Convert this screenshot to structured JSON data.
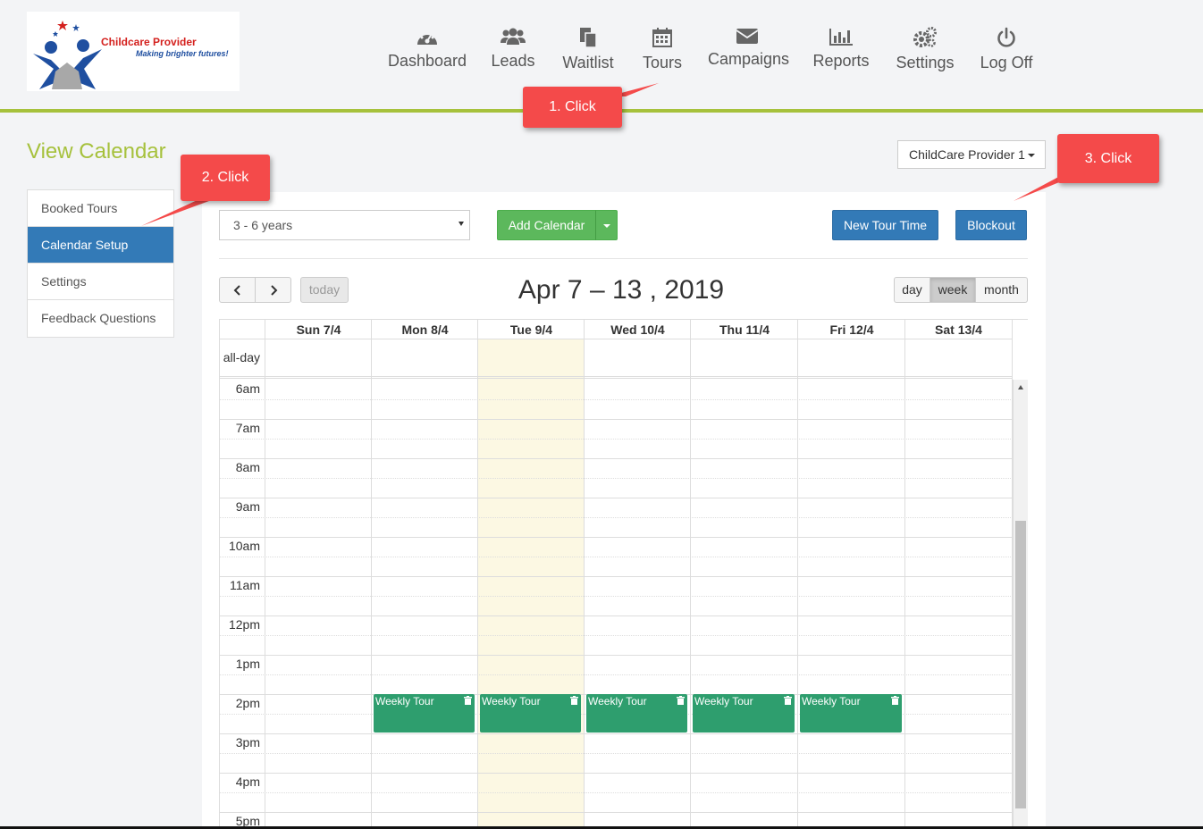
{
  "logo": {
    "name": "Childcare Provider",
    "tagline": "Making brighter futures!"
  },
  "nav": [
    {
      "label": "Dashboard",
      "icon": "dashboard-icon"
    },
    {
      "label": "Leads",
      "icon": "users-icon"
    },
    {
      "label": "Waitlist",
      "icon": "copy-icon"
    },
    {
      "label": "Tours",
      "icon": "calendar-icon"
    },
    {
      "label": "Campaigns",
      "icon": "envelope-icon"
    },
    {
      "label": "Reports",
      "icon": "bar-chart-icon"
    },
    {
      "label": "Settings",
      "icon": "gears-icon"
    },
    {
      "label": "Log Off",
      "icon": "power-icon"
    }
  ],
  "page_title": "View Calendar",
  "sidebar": {
    "items": [
      "Booked Tours",
      "Calendar Setup",
      "Settings",
      "Feedback Questions"
    ],
    "active": "Calendar Setup"
  },
  "provider_select": "ChildCare Provider 1",
  "toolbar": {
    "calendar_select": "3 - 6 years",
    "add_calendar": "Add Calendar",
    "new_tour_time": "New Tour Time",
    "blockout": "Blockout"
  },
  "calendar": {
    "prev_icon": "chevron-left-icon",
    "next_icon": "chevron-right-icon",
    "today": "today",
    "title": "Apr 7 – 13 , 2019",
    "views": [
      "day",
      "week",
      "month"
    ],
    "active_view": "week",
    "days": [
      "Sun 7/4",
      "Mon 8/4",
      "Tue 9/4",
      "Wed 10/4",
      "Thu 11/4",
      "Fri 12/4",
      "Sat 13/4"
    ],
    "today_day": "Tue 9/4",
    "allday_label": "all-day",
    "times": [
      "6am",
      "7am",
      "8am",
      "9am",
      "10am",
      "11am",
      "12pm",
      "1pm",
      "2pm",
      "3pm",
      "4pm",
      "5pm"
    ],
    "events": [
      {
        "day": "Mon 8/4",
        "start": "2pm",
        "end": "3pm",
        "title": "Weekly Tour"
      },
      {
        "day": "Tue 9/4",
        "start": "2pm",
        "end": "3pm",
        "title": "Weekly Tour"
      },
      {
        "day": "Wed 10/4",
        "start": "2pm",
        "end": "3pm",
        "title": "Weekly Tour"
      },
      {
        "day": "Thu 11/4",
        "start": "2pm",
        "end": "3pm",
        "title": "Weekly Tour"
      },
      {
        "day": "Fri 12/4",
        "start": "2pm",
        "end": "3pm",
        "title": "Weekly Tour"
      }
    ]
  },
  "callouts": [
    "1. Click",
    "2. Click",
    "3. Click"
  ],
  "colors": {
    "accent": "#a6c13c",
    "primary": "#337ab7",
    "success": "#5cb85c",
    "event": "#2e9e6e",
    "callout": "#f44a4a",
    "today": "#fcf8e3"
  }
}
